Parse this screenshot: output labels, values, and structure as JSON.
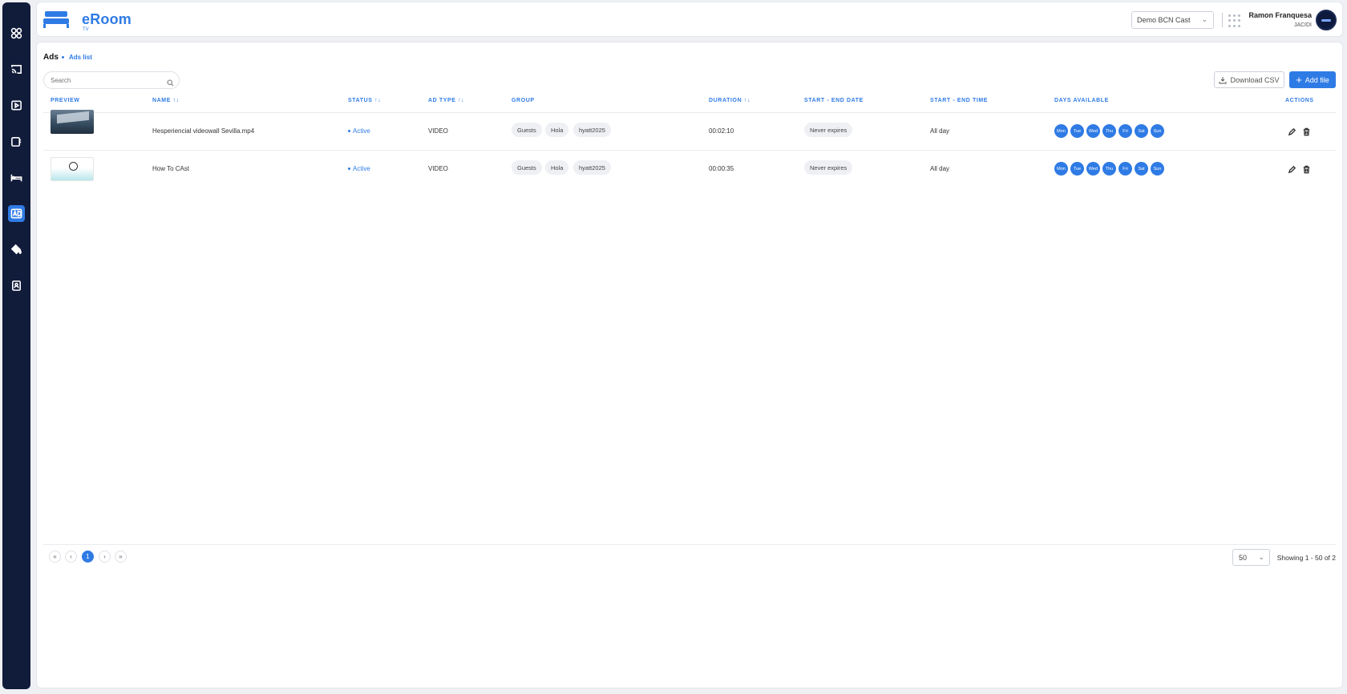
{
  "app": {
    "name": "eRoom",
    "sub": "TV"
  },
  "sidebar": {
    "items": [
      {
        "name": "dashboard",
        "icon": "grid-icon"
      },
      {
        "name": "cast",
        "icon": "cast-icon"
      },
      {
        "name": "media",
        "icon": "play-icon"
      },
      {
        "name": "devices",
        "icon": "device-icon"
      },
      {
        "name": "rooms",
        "icon": "bed-icon"
      },
      {
        "name": "ads",
        "icon": "ad-icon",
        "active": true
      },
      {
        "name": "branding",
        "icon": "paint-bucket-icon"
      },
      {
        "name": "contacts",
        "icon": "contact-icon"
      }
    ]
  },
  "header": {
    "organization": "Demo BCN Cast",
    "user_name": "Ramon Franquesa",
    "user_org": "JACIDI"
  },
  "page": {
    "title": "Ads",
    "breadcrumb": "Ads list",
    "search_placeholder": "Search",
    "download_csv": "Download CSV",
    "add_file": "Add file"
  },
  "table": {
    "columns": {
      "preview": "PREVIEW",
      "name": "NAME ↑↓",
      "status": "STATUS ↑↓",
      "ad_type": "AD TYPE ↑↓",
      "group": "GROUP",
      "duration": "DURATION ↑↓",
      "date": "START - END DATE",
      "time": "START - END TIME",
      "days": "DAYS AVAILABLE",
      "actions": "ACTIONS"
    },
    "days": [
      "Mon",
      "Tue",
      "Wed",
      "Thu",
      "Fri",
      "Sat",
      "Sun"
    ],
    "rows": [
      {
        "name": "Hesperiencial videowall Sevilla.mp4",
        "status": "Active",
        "ad_type": "VIDEO",
        "groups": [
          "Guests",
          "Hola",
          "hyatt2025"
        ],
        "duration": "00:02:10",
        "date": "Never expires",
        "time": "All day"
      },
      {
        "name": "How To CAst",
        "status": "Active",
        "ad_type": "VIDEO",
        "groups": [
          "Guests",
          "Hola",
          "hyatt2025"
        ],
        "duration": "00:00:35",
        "date": "Never expires",
        "time": "All day"
      }
    ]
  },
  "pagination": {
    "first": "«",
    "prev": "‹",
    "current": "1",
    "next": "›",
    "last": "»",
    "per_page": "50",
    "showing": "Showing 1 - 50 of 2"
  },
  "colors": {
    "accent": "#2f7be5",
    "sidebar": "#111b3a"
  }
}
